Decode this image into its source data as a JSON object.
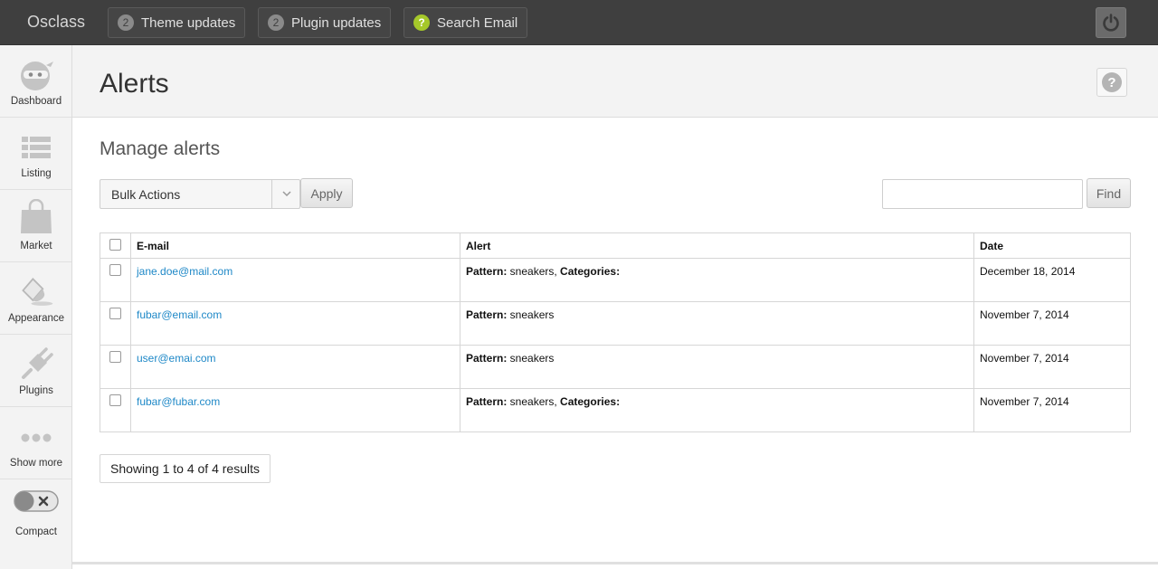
{
  "topbar": {
    "brand": "Osclass",
    "theme_updates": {
      "count": "2",
      "label": "Theme updates"
    },
    "plugin_updates": {
      "count": "2",
      "label": "Plugin updates"
    },
    "search_email": {
      "badge": "?",
      "label": "Search Email"
    },
    "power_icon": "power-icon"
  },
  "sidebar": {
    "items": [
      {
        "label": "Dashboard",
        "icon": "dashboard-ninja-icon"
      },
      {
        "label": "Listing",
        "icon": "list-icon"
      },
      {
        "label": "Market",
        "icon": "shopping-bag-icon"
      },
      {
        "label": "Appearance",
        "icon": "paint-bucket-icon"
      },
      {
        "label": "Plugins",
        "icon": "plug-icon"
      },
      {
        "label": "Show more",
        "icon": "ellipsis-icon"
      }
    ],
    "compact_label": "Compact"
  },
  "header": {
    "title": "Alerts",
    "help_badge": "?"
  },
  "main": {
    "section_title": "Manage alerts",
    "bulk_actions": "Bulk Actions",
    "apply_label": "Apply",
    "find_label": "Find",
    "search_value": ""
  },
  "table": {
    "headers": {
      "email": "E-mail",
      "alert": "Alert",
      "date": "Date"
    },
    "rows": [
      {
        "email": "jane.doe@mail.com",
        "pattern_label": "Pattern:",
        "pattern": " sneakers, ",
        "categories_label": "Categories:",
        "date": "December 18, 2014"
      },
      {
        "email": "fubar@email.com",
        "pattern_label": "Pattern:",
        "pattern": " sneakers",
        "categories_label": "",
        "date": "November 7, 2014"
      },
      {
        "email": "user@emai.com",
        "pattern_label": "Pattern:",
        "pattern": " sneakers",
        "categories_label": "",
        "date": "November 7, 2014"
      },
      {
        "email": "fubar@fubar.com",
        "pattern_label": "Pattern:",
        "pattern": " sneakers, ",
        "categories_label": "Categories:",
        "date": "November 7, 2014"
      }
    ]
  },
  "footer": {
    "showing": "Showing 1 to 4 of 4 results"
  },
  "colors": {
    "topbar": "#3f3f3f",
    "link": "#1e88c7",
    "badge_green": "#a5c82a"
  }
}
